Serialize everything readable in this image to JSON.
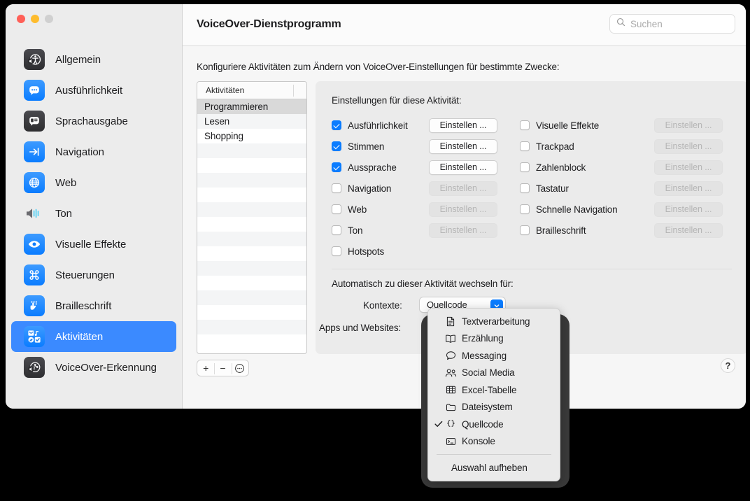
{
  "window": {
    "title": "VoiceOver-Dienstprogramm",
    "traffic_lights": [
      "close",
      "minimize",
      "zoom"
    ]
  },
  "search": {
    "placeholder": "Suchen",
    "icon": "search-icon",
    "value": ""
  },
  "sidebar": {
    "items": [
      {
        "label": "Allgemein",
        "icon": "accessibility-icon",
        "selected": false
      },
      {
        "label": "Ausführlichkeit",
        "icon": "speech-bubble-icon",
        "selected": false
      },
      {
        "label": "Sprachausgabe",
        "icon": "speech-panel-icon",
        "selected": false
      },
      {
        "label": "Navigation",
        "icon": "arrow-right-icon",
        "selected": false
      },
      {
        "label": "Web",
        "icon": "globe-icon",
        "selected": false
      },
      {
        "label": "Ton",
        "icon": "speaker-icon",
        "selected": false
      },
      {
        "label": "Visuelle Effekte",
        "icon": "eye-icon",
        "selected": false
      },
      {
        "label": "Steuerungen",
        "icon": "command-key-icon",
        "selected": false
      },
      {
        "label": "Brailleschrift",
        "icon": "hand-touch-icon",
        "selected": false
      },
      {
        "label": "Aktivitäten",
        "icon": "activities-grid-icon",
        "selected": true
      },
      {
        "label": "VoiceOver-Erkennung",
        "icon": "recognition-icon",
        "selected": false
      }
    ]
  },
  "main": {
    "intro": "Konfiguriere Aktivitäten zum Ändern von VoiceOver-Einstellungen für bestimmte Zwecke:",
    "activities_table": {
      "header": "Aktivitäten",
      "rows": [
        {
          "label": "Programmieren",
          "selected": true
        },
        {
          "label": "Lesen",
          "selected": false
        },
        {
          "label": "Shopping",
          "selected": false
        }
      ],
      "empty_rows": 14
    },
    "table_toolbar": {
      "add_label": "+",
      "remove_label": "−",
      "more_label": "•••"
    },
    "help_label": "?"
  },
  "panel": {
    "title": "Einstellungen für diese Aktivität:",
    "settings_left": [
      {
        "label": "Ausführlichkeit",
        "checked": true,
        "button": "Einstellen ...",
        "button_enabled": true
      },
      {
        "label": "Stimmen",
        "checked": true,
        "button": "Einstellen ...",
        "button_enabled": true
      },
      {
        "label": "Aussprache",
        "checked": true,
        "button": "Einstellen ...",
        "button_enabled": true
      },
      {
        "label": "Navigation",
        "checked": false,
        "button": "Einstellen ...",
        "button_enabled": false
      },
      {
        "label": "Web",
        "checked": false,
        "button": "Einstellen ...",
        "button_enabled": false
      },
      {
        "label": "Ton",
        "checked": false,
        "button": "Einstellen ...",
        "button_enabled": false
      },
      {
        "label": "Hotspots",
        "checked": false,
        "button": null,
        "button_enabled": false
      }
    ],
    "settings_right": [
      {
        "label": "Visuelle Effekte",
        "checked": false,
        "button": "Einstellen ...",
        "button_enabled": false
      },
      {
        "label": "Trackpad",
        "checked": false,
        "button": "Einstellen ...",
        "button_enabled": false
      },
      {
        "label": "Zahlenblock",
        "checked": false,
        "button": "Einstellen ...",
        "button_enabled": false
      },
      {
        "label": "Tastatur",
        "checked": false,
        "button": "Einstellen ...",
        "button_enabled": false
      },
      {
        "label": "Schnelle Navigation",
        "checked": false,
        "button": "Einstellen ...",
        "button_enabled": false
      },
      {
        "label": "Brailleschrift",
        "checked": false,
        "button": "Einstellen ...",
        "button_enabled": false
      }
    ],
    "auto_switch_title": "Automatisch zu dieser Aktivität wechseln für:",
    "kontexte_label": "Kontexte:",
    "kontexte_value": "Quellcode",
    "apps_label": "Apps und Websites:"
  },
  "menu": {
    "items": [
      {
        "label": "Textverarbeitung",
        "icon": "document-icon",
        "checked": false
      },
      {
        "label": "Erzählung",
        "icon": "book-icon",
        "checked": false
      },
      {
        "label": "Messaging",
        "icon": "bubble-icon",
        "checked": false
      },
      {
        "label": "Social Media",
        "icon": "people-icon",
        "checked": false
      },
      {
        "label": "Excel-Tabelle",
        "icon": "table-icon",
        "checked": false
      },
      {
        "label": "Dateisystem",
        "icon": "folder-icon",
        "checked": false
      },
      {
        "label": "Quellcode",
        "icon": "braces-icon",
        "checked": true
      },
      {
        "label": "Konsole",
        "icon": "terminal-icon",
        "checked": false
      }
    ],
    "footer_label": "Auswahl aufheben"
  },
  "colors": {
    "accent": "#0a7cff",
    "selection": "#3b8aff",
    "window_bg": "#ececec",
    "panel_bg": "#ebebeb"
  }
}
